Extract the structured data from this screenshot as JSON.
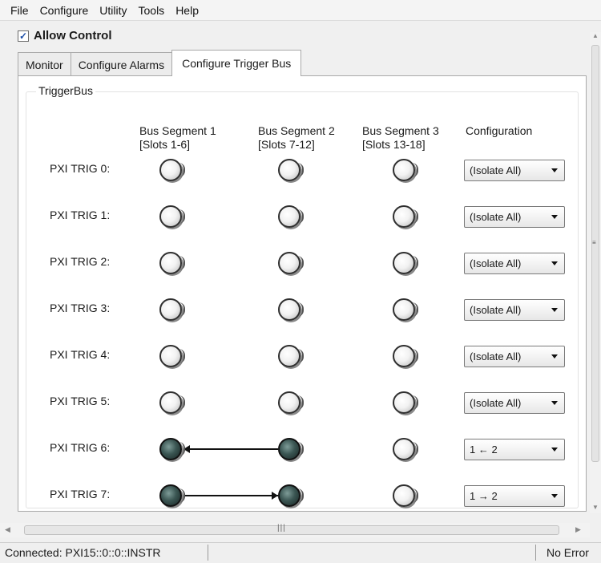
{
  "menu": [
    "File",
    "Configure",
    "Utility",
    "Tools",
    "Help"
  ],
  "allow_control": {
    "label": "Allow Control",
    "checked": true
  },
  "tabs": [
    {
      "label": "Monitor",
      "active": false
    },
    {
      "label": "Configure Alarms",
      "active": false
    },
    {
      "label": "Configure Trigger Bus",
      "active": true
    }
  ],
  "group_label": "TriggerBus",
  "columns": [
    {
      "line1": "Bus Segment 1",
      "line2": "[Slots 1-6]"
    },
    {
      "line1": "Bus Segment 2",
      "line2": "[Slots 7-12]"
    },
    {
      "line1": "Bus Segment 3",
      "line2": "[Slots 13-18]"
    },
    {
      "line1": "Configuration",
      "line2": ""
    }
  ],
  "rows": [
    {
      "label": "PXI TRIG 0:",
      "config": "(Isolate All)",
      "active": [
        false,
        false,
        false
      ],
      "link": "none"
    },
    {
      "label": "PXI TRIG 1:",
      "config": "(Isolate All)",
      "active": [
        false,
        false,
        false
      ],
      "link": "none"
    },
    {
      "label": "PXI TRIG 2:",
      "config": "(Isolate All)",
      "active": [
        false,
        false,
        false
      ],
      "link": "none"
    },
    {
      "label": "PXI TRIG 3:",
      "config": "(Isolate All)",
      "active": [
        false,
        false,
        false
      ],
      "link": "none"
    },
    {
      "label": "PXI TRIG 4:",
      "config": "(Isolate All)",
      "active": [
        false,
        false,
        false
      ],
      "link": "none"
    },
    {
      "label": "PXI TRIG 5:",
      "config": "(Isolate All)",
      "active": [
        false,
        false,
        false
      ],
      "link": "none"
    },
    {
      "label": "PXI TRIG 6:",
      "config": "1 ← 2",
      "active": [
        true,
        true,
        false
      ],
      "link": "left"
    },
    {
      "label": "PXI TRIG 7:",
      "config": "1 → 2",
      "active": [
        true,
        true,
        false
      ],
      "link": "right"
    }
  ],
  "status": {
    "connection": "Connected: PXI15::0::0::INSTR",
    "error": "No Error"
  },
  "colors": {
    "led_on": "#2f4a47",
    "led_off": "#ffffff",
    "accent": "#1d4fa8"
  },
  "icons": {
    "checkbox": "checkmark-icon",
    "dropdown": "caret-down-icon"
  }
}
